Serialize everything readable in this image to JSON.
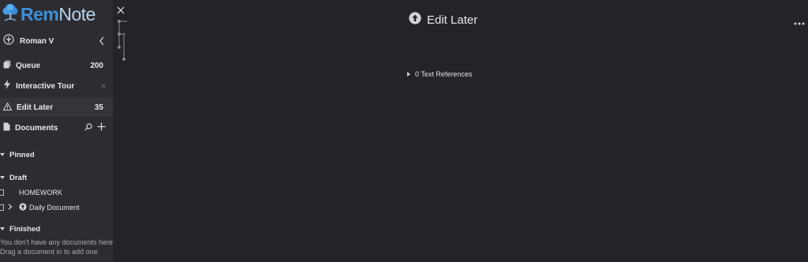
{
  "logo": {
    "rem": "Rem",
    "note": "Note"
  },
  "user": {
    "name": "Roman V"
  },
  "nav": {
    "queue": {
      "label": "Queue",
      "count": "200"
    },
    "tour": {
      "label": "Interactive Tour",
      "close": "✕"
    },
    "edit_later": {
      "label": "Edit Later",
      "count": "35"
    },
    "documents": {
      "label": "Documents"
    }
  },
  "sections": {
    "pinned": "Pinned",
    "draft": "Draft",
    "finished": "Finished"
  },
  "draft_docs": [
    {
      "label": "HOMEWORK"
    },
    {
      "label": "Daily Document"
    }
  ],
  "finished_empty": {
    "line1": "You don't have any documents here.",
    "line2": "Drag a document in to add one."
  },
  "main": {
    "title": "Edit Later",
    "references": "0 Text References"
  },
  "colors": {
    "sidebar_bg": "#2c2c31",
    "main_bg": "#242428",
    "brand_blue": "#3e8fd8",
    "brand_light": "#b7d3ee"
  }
}
